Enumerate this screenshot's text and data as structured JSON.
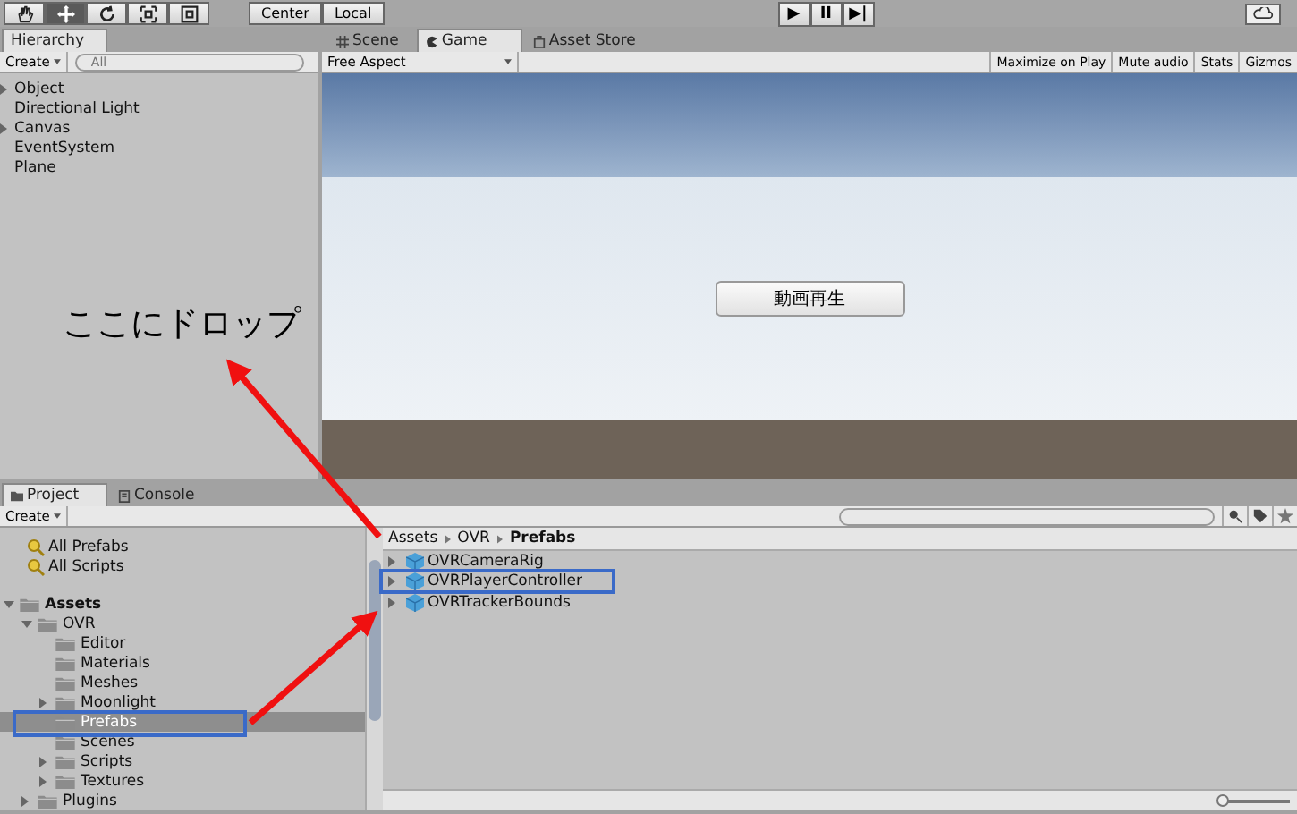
{
  "toolbar": {
    "tools": [
      {
        "kind": "hand",
        "selected": false
      },
      {
        "kind": "move",
        "selected": true
      },
      {
        "kind": "rotate",
        "selected": false
      },
      {
        "kind": "scale",
        "selected": false
      },
      {
        "kind": "rect",
        "selected": false
      }
    ],
    "pivot": [
      {
        "label": "Center"
      },
      {
        "label": "Local"
      }
    ],
    "playback": [
      {
        "label": "▶"
      },
      {
        "label": "II"
      },
      {
        "label": "▶|"
      }
    ]
  },
  "hierarchy": {
    "tab": "Hierarchy",
    "create": "Create",
    "search_placeholder": "All",
    "items": [
      {
        "label": "Object",
        "expandable": true
      },
      {
        "label": "Directional Light",
        "expandable": false
      },
      {
        "label": "Canvas",
        "expandable": true
      },
      {
        "label": "EventSystem",
        "expandable": false
      },
      {
        "label": "Plane",
        "expandable": false
      }
    ]
  },
  "view_tabs": [
    {
      "label": "Scene",
      "kind": "scene",
      "selected": false
    },
    {
      "label": "Game",
      "kind": "game",
      "selected": true
    },
    {
      "label": "Asset Store",
      "kind": "store",
      "selected": false
    }
  ],
  "game": {
    "aspect": "Free Aspect",
    "options": [
      "Maximize on Play",
      "Mute audio",
      "Stats",
      "Gizmos"
    ],
    "button": "動画再生"
  },
  "project": {
    "tabs": [
      {
        "label": "Project",
        "kind": "project",
        "selected": true
      },
      {
        "label": "Console",
        "kind": "console",
        "selected": false
      }
    ],
    "create": "Create",
    "favorites": [
      "All Prefabs",
      "All Scripts"
    ],
    "tree": [
      {
        "label": "Assets",
        "bold": true,
        "expanded": true,
        "selected": false,
        "children": [
          {
            "label": "OVR",
            "bold": false,
            "expanded": true,
            "selected": false,
            "children": [
              {
                "label": "Editor",
                "selected": false
              },
              {
                "label": "Materials",
                "selected": false
              },
              {
                "label": "Meshes",
                "selected": false
              },
              {
                "label": "Moonlight",
                "expanded": false,
                "selected": false
              },
              {
                "label": "Prefabs",
                "selected": true
              },
              {
                "label": "Scenes",
                "selected": false
              },
              {
                "label": "Scripts",
                "expanded": false,
                "selected": false
              },
              {
                "label": "Textures",
                "expanded": false,
                "selected": false
              }
            ]
          },
          {
            "label": "Plugins",
            "expanded": false,
            "selected": false
          }
        ]
      }
    ],
    "breadcrumb": [
      "Assets",
      "OVR",
      "Prefabs"
    ],
    "assets": [
      "OVRCameraRig",
      "OVRPlayerController",
      "OVRTrackerBounds"
    ],
    "zoom": {
      "level": 0.05
    }
  },
  "annotation": {
    "callout": "ここにドロップ"
  }
}
